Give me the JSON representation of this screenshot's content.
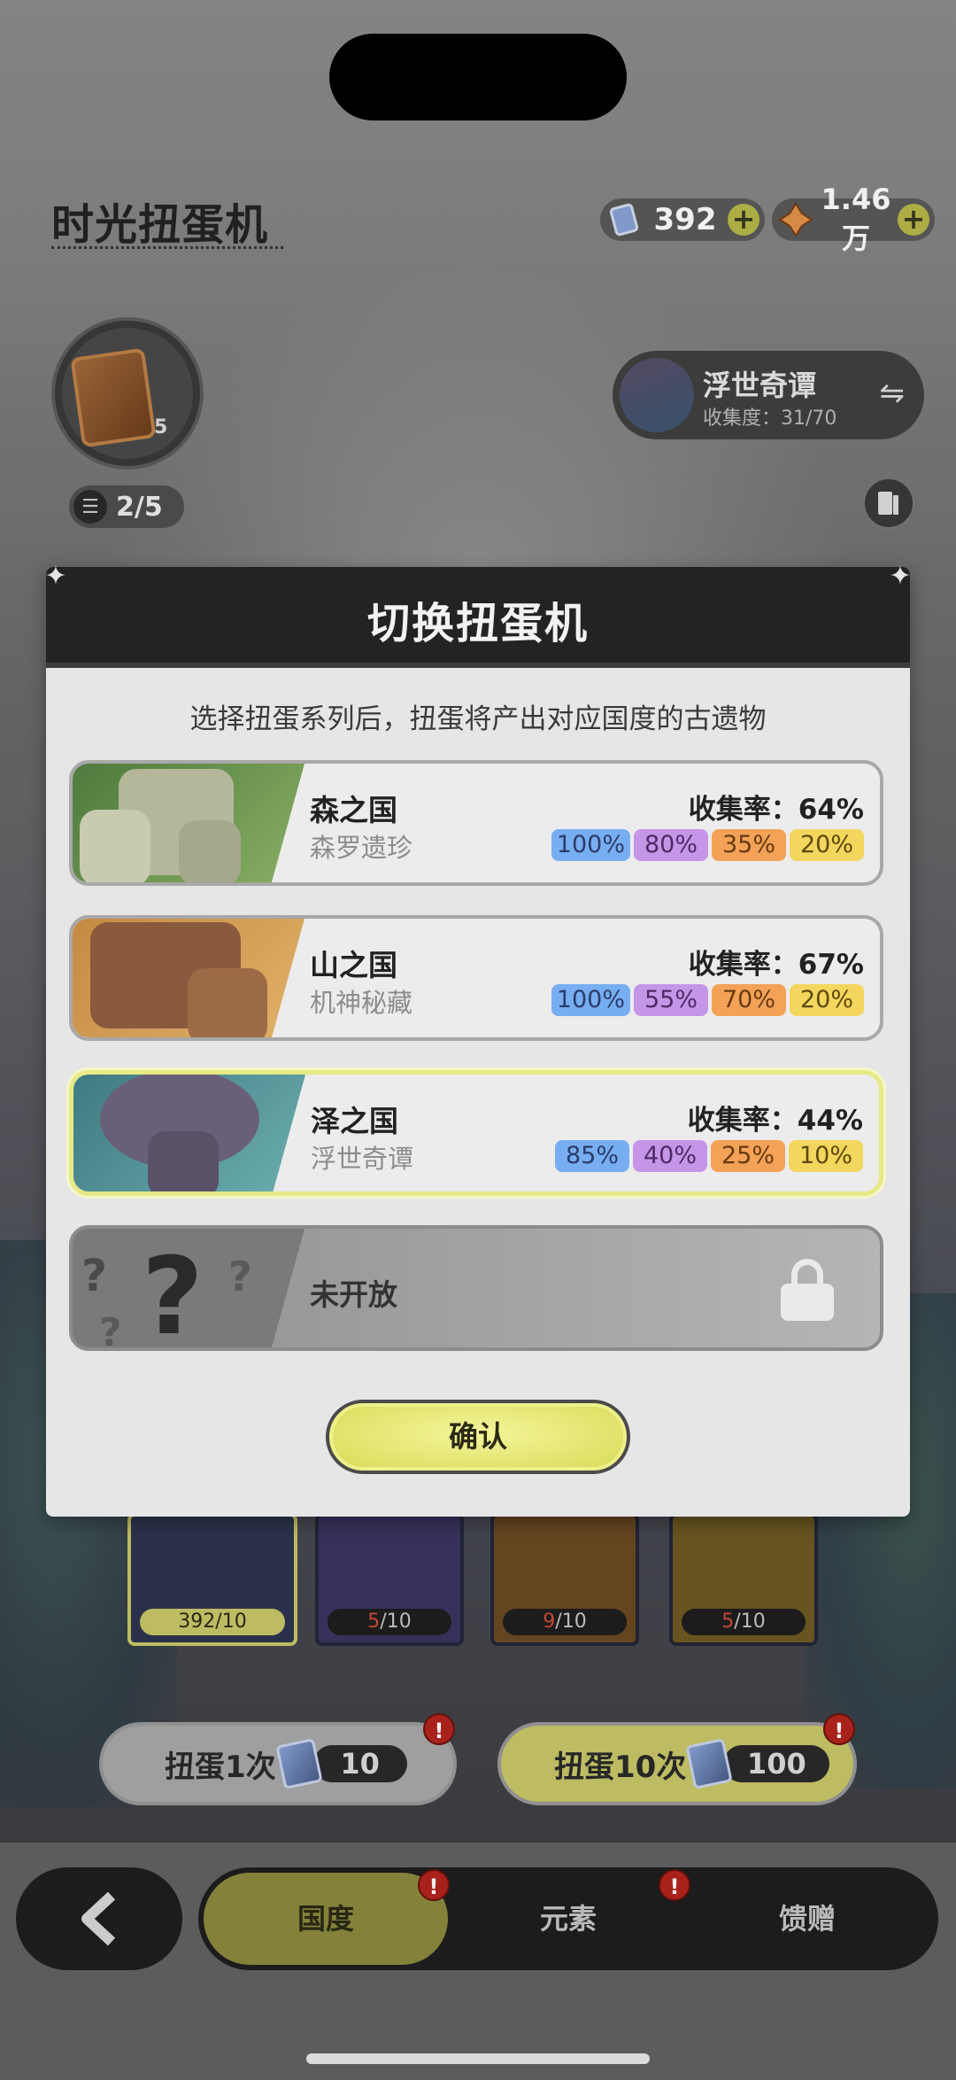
{
  "header": {
    "title": "时光扭蛋机",
    "currency_tickets": "392",
    "currency_coins": "1.46万",
    "plus_glyph": "+"
  },
  "avatar": {
    "count": "5"
  },
  "progress": {
    "label": "2/5"
  },
  "current_series": {
    "name": "浮世奇谭",
    "collection": "收集度：31/70"
  },
  "dialog": {
    "title": "切换扭蛋机",
    "subtitle": "选择扭蛋系列后，扭蛋将产出对应国度的古遗物",
    "options": [
      {
        "name": "森之国",
        "sub": "森罗遗珍",
        "rate": "收集率：64%",
        "rates": [
          "100%",
          "80%",
          "35%",
          "20%"
        ]
      },
      {
        "name": "山之国",
        "sub": "机神秘藏",
        "rate": "收集率：67%",
        "rates": [
          "100%",
          "55%",
          "70%",
          "20%"
        ]
      },
      {
        "name": "泽之国",
        "sub": "浮世奇谭",
        "rate": "收集率：44%",
        "rates": [
          "85%",
          "40%",
          "25%",
          "10%"
        ]
      }
    ],
    "locked_label": "未开放",
    "confirm": "确认"
  },
  "cards": [
    {
      "count": "392",
      "total": "/10"
    },
    {
      "count": "5",
      "total": "/10"
    },
    {
      "count": "9",
      "total": "/10"
    },
    {
      "count": "5",
      "total": "/10"
    }
  ],
  "draw": {
    "single_label": "扭蛋1次",
    "single_cost": "10",
    "ten_label": "扭蛋10次",
    "ten_cost": "100",
    "alert": "!"
  },
  "nav": {
    "tabs": [
      "国度",
      "元素",
      "馈赠"
    ],
    "active": "国度"
  },
  "colors": {
    "accent_yellow": "#d8da55",
    "rate_blue": "#77aef2",
    "rate_purple": "#c596e8",
    "rate_orange": "#f3a257",
    "rate_yellow": "#f3d65d",
    "alert_red": "#b3251d"
  },
  "icons": [
    "ticket-icon",
    "coin-icon",
    "plus-icon",
    "list-icon",
    "swap-icon",
    "book-icon",
    "lock-icon",
    "back-arrow-icon",
    "alert-icon"
  ]
}
